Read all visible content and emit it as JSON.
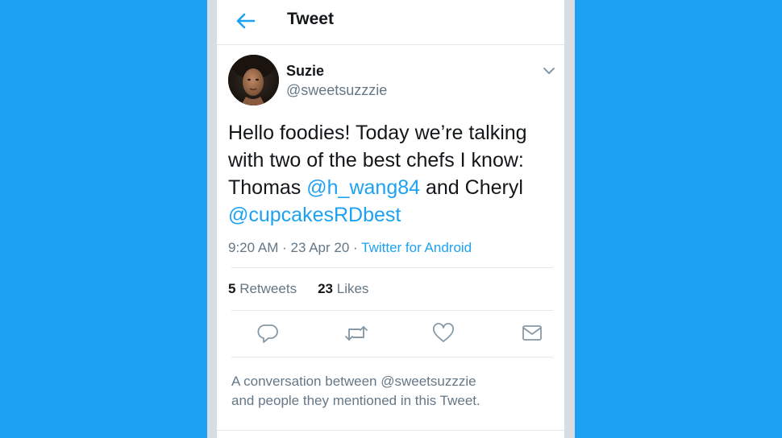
{
  "header": {
    "back_icon": "arrow-left-icon",
    "title": "Tweet"
  },
  "tweet": {
    "display_name": "Suzie",
    "handle": "@sweetsuzzzie",
    "text_parts": {
      "p1": "Hello foodies! Today we’re talking with two of the best chefs I know: Thomas ",
      "m1": "@h_wang84",
      "p2": " and Cheryl ",
      "m2": "@cupcakesRDbest"
    },
    "time": "9:20 AM",
    "separator": "·",
    "date": "23 Apr 20",
    "source": "Twitter for Android",
    "retweets": {
      "count": "5",
      "label": "Retweets"
    },
    "likes": {
      "count": "23",
      "label": "Likes"
    }
  },
  "actions": [
    {
      "icon": "reply-icon"
    },
    {
      "icon": "retweet-icon"
    },
    {
      "icon": "like-icon"
    },
    {
      "icon": "share-icon"
    }
  ],
  "conversation": {
    "line1": "A conversation between @sweetsuzzzie",
    "line2": "and people they mentioned in this Tweet."
  },
  "colors": {
    "background": "#1DA1F2",
    "accent": "#1DA1F2",
    "text_primary": "#14171a",
    "text_secondary": "#657786",
    "divider": "#e1e8ed",
    "icon": "#657786"
  }
}
